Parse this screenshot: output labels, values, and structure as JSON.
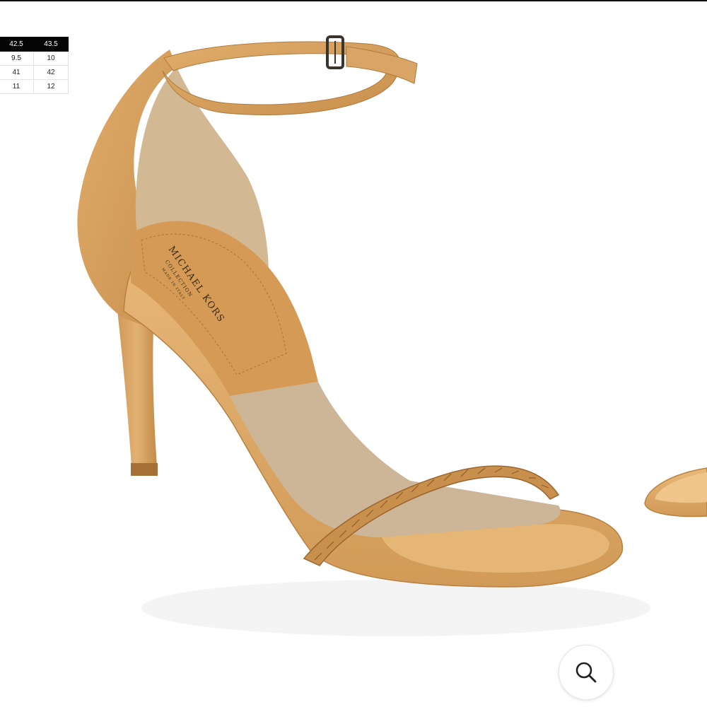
{
  "size_chart": {
    "rows": [
      [
        "42.5",
        "43.5"
      ],
      [
        "9.5",
        "10"
      ],
      [
        "41",
        "42"
      ],
      [
        "11",
        "12"
      ]
    ]
  },
  "product_image": {
    "insole_brand": "MICHAEL KORS",
    "insole_sub": "COLLECTION",
    "insole_origin": "MADE IN ITALY"
  },
  "zoom": {
    "icon": "magnifier-icon"
  },
  "colors": {
    "leather": "#D8A25F",
    "suede": "#CDB698",
    "header_bg": "#050505"
  }
}
